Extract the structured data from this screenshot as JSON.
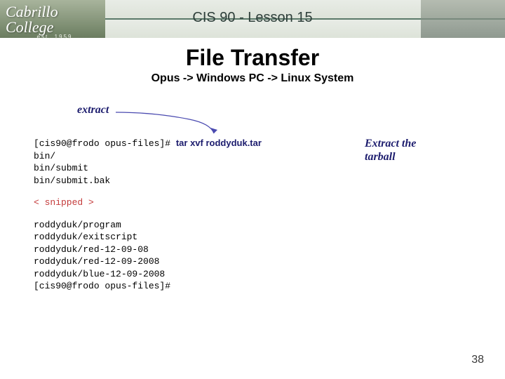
{
  "header": {
    "college": "Cabrillo College",
    "est": "est. 1959",
    "lesson": "CIS 90 - Lesson 15"
  },
  "title": "File Transfer",
  "subtitle": "Opus -> Windows PC -> Linux System",
  "extract_label": "extract",
  "terminal": {
    "prompt1": "[cis90@frodo opus-files]# ",
    "command": "tar xvf roddyduk.tar",
    "out1": [
      "bin/",
      "bin/submit",
      "bin/submit.bak"
    ],
    "snip": "< snipped >",
    "out2": [
      "roddyduk/program",
      "roddyduk/exitscript",
      "roddyduk/red-12-09-08",
      "roddyduk/red-12-09-2008",
      "roddyduk/blue-12-09-2008"
    ],
    "prompt2": "[cis90@frodo opus-files]#"
  },
  "annotation": {
    "line1": "Extract the",
    "line2": "tarball"
  },
  "page_number": "38"
}
